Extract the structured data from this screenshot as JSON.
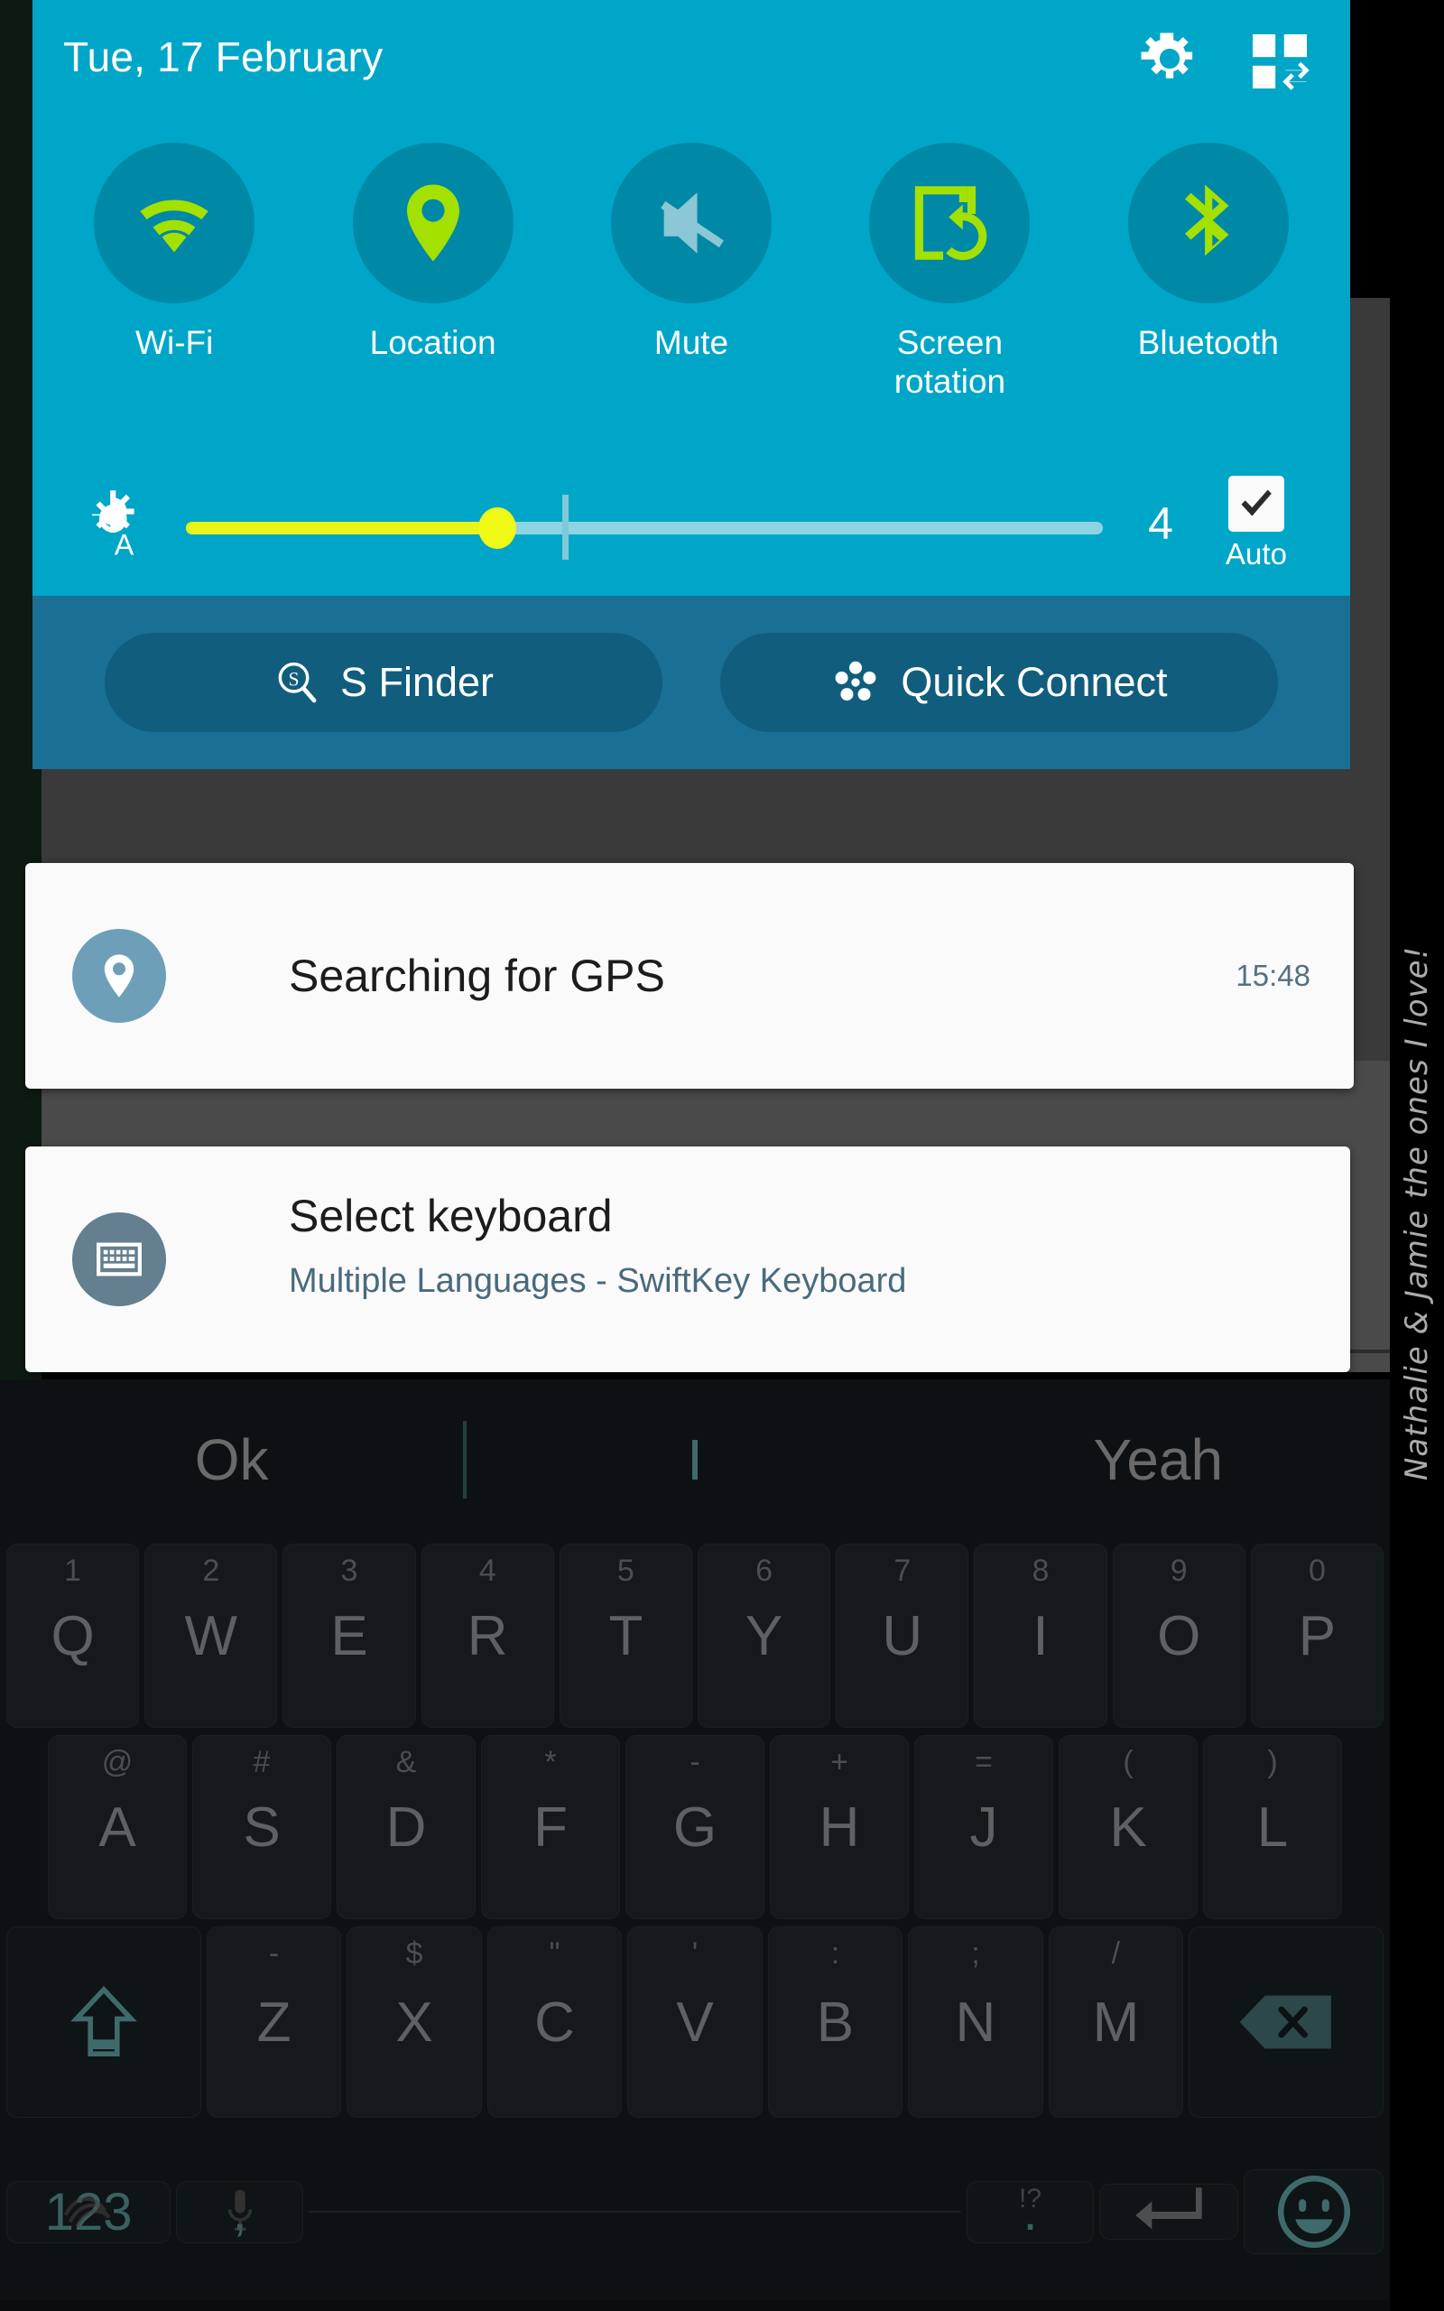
{
  "status_panel": {
    "date": "Tue, 17 February",
    "gear_icon": "gear-icon",
    "edit_icon": "quick-settings-edit-icon",
    "toggles": [
      {
        "label": "Wi-Fi",
        "icon": "wifi-icon",
        "active": true
      },
      {
        "label": "Location",
        "icon": "location-pin-icon",
        "active": true
      },
      {
        "label": "Mute",
        "icon": "mute-speaker-icon",
        "active": false
      },
      {
        "label": "Screen\nrotation",
        "label_line1": "Screen",
        "label_line2": "rotation",
        "icon": "screen-rotation-icon",
        "active": true
      },
      {
        "label": "Bluetooth",
        "icon": "bluetooth-icon",
        "active": true
      }
    ],
    "brightness": {
      "icon": "auto-brightness-icon",
      "value": "4",
      "fill_percent": 34,
      "tick_percent": 41,
      "auto_label": "Auto",
      "auto_checked": true
    },
    "actions": [
      {
        "label": "S Finder",
        "icon": "s-finder-icon"
      },
      {
        "label": "Quick Connect",
        "icon": "quick-connect-icon"
      }
    ]
  },
  "notifications": [
    {
      "icon": "location-pin-icon",
      "title": "Searching for GPS",
      "time": "15:48",
      "subtitle": ""
    },
    {
      "icon": "keyboard-icon",
      "title": "Select keyboard",
      "subtitle": "Multiple Languages - SwiftKey Keyboard",
      "time": ""
    }
  ],
  "keyboard": {
    "suggestions": [
      "Ok",
      "I",
      "Yeah"
    ],
    "active_suggestion_index": 1,
    "row1": [
      {
        "key": "Q",
        "hint": "1"
      },
      {
        "key": "W",
        "hint": "2"
      },
      {
        "key": "E",
        "hint": "3"
      },
      {
        "key": "R",
        "hint": "4"
      },
      {
        "key": "T",
        "hint": "5"
      },
      {
        "key": "Y",
        "hint": "6"
      },
      {
        "key": "U",
        "hint": "7"
      },
      {
        "key": "I",
        "hint": "8"
      },
      {
        "key": "O",
        "hint": "9"
      },
      {
        "key": "P",
        "hint": "0"
      }
    ],
    "row2": [
      {
        "key": "A",
        "hint": "@"
      },
      {
        "key": "S",
        "hint": "#"
      },
      {
        "key": "D",
        "hint": "&"
      },
      {
        "key": "F",
        "hint": "*"
      },
      {
        "key": "G",
        "hint": "-"
      },
      {
        "key": "H",
        "hint": "+"
      },
      {
        "key": "J",
        "hint": "="
      },
      {
        "key": "K",
        "hint": "("
      },
      {
        "key": "L",
        "hint": ")"
      }
    ],
    "row3": [
      {
        "key": "Z",
        "hint": "-"
      },
      {
        "key": "X",
        "hint": "$"
      },
      {
        "key": "C",
        "hint": "\""
      },
      {
        "key": "V",
        "hint": "'"
      },
      {
        "key": "B",
        "hint": ":"
      },
      {
        "key": "N",
        "hint": ";"
      },
      {
        "key": "M",
        "hint": "/"
      }
    ],
    "shift_icon": "shift-arrow-icon",
    "backspace_icon": "backspace-icon",
    "row4": {
      "num_label": "123",
      "num_top_icon": "swipe-flow-icon",
      "comma_label": ",",
      "comma_top_icon": "microphone-icon",
      "space_label": "",
      "period_label": ".",
      "period_hint": "!?",
      "enter_icon": "enter-return-icon",
      "emoji_icon": "emoji-smiley-icon"
    }
  },
  "overlay_note": {
    "text": "Nathalie & Jamie the ones I love!"
  },
  "colors": {
    "panel_bg": "#00a6c8",
    "toggle_circle": "#0089a6",
    "accent_green": "#a4e000",
    "actions_bg": "#1a6f94",
    "pill_bg": "#115d7e",
    "slider_fill": "#e8f518",
    "notif_bg": "#fafafa",
    "keyboard_bg": "#0d1113"
  }
}
